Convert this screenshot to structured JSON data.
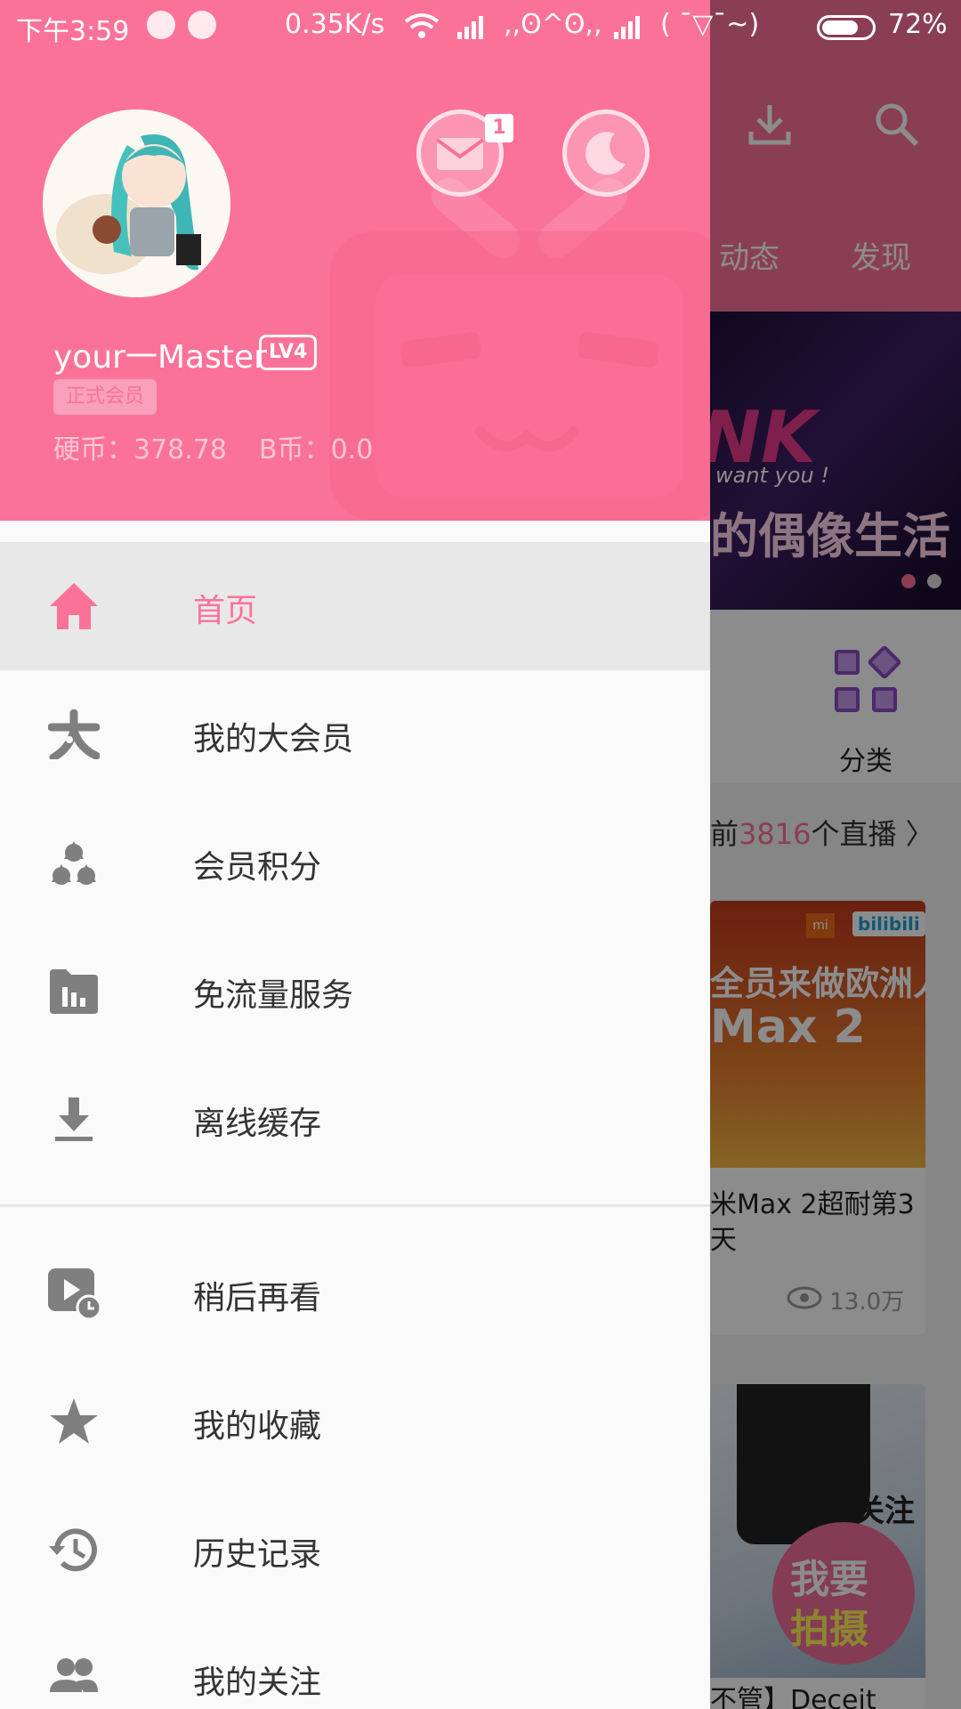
{
  "status_bar": {
    "time": "下午3:59",
    "speed": "0.35K/s",
    "signal_text": ",,ʘ^ʘ,,",
    "face_text": "( ¯▽¯~)",
    "battery": "72%"
  },
  "colors": {
    "accent": "#FB7299",
    "mail_button": "#FDD2DD",
    "night_button": "#FED8E2",
    "label": "#333333",
    "icon": "#7F7F7F",
    "drawer_bg": "#FAFAFA",
    "coin_text": "#FDC6D6",
    "username": "#FFFFFF"
  },
  "profile": {
    "username": "your一Master",
    "level": "LV4",
    "member_tag": "正式会员",
    "hard_coins": "硬币：378.78",
    "b_coins": "B币：0.0",
    "mail_badge": "1"
  },
  "menu": [
    {
      "label": "首页",
      "icon": "home-icon",
      "active": true
    },
    {
      "label": "我的大会员",
      "icon": "vip-icon",
      "active": false
    },
    {
      "label": "会员积分",
      "icon": "points-icon",
      "active": false
    },
    {
      "label": "免流量服务",
      "icon": "free-data-icon",
      "active": false
    },
    {
      "label": "离线缓存",
      "icon": "download-icon",
      "active": false
    }
  ],
  "menu2": [
    {
      "label": "稍后再看",
      "icon": "watch-later-icon"
    },
    {
      "label": "我的收藏",
      "icon": "star-icon"
    },
    {
      "label": "历史记录",
      "icon": "history-icon"
    },
    {
      "label": "我的关注",
      "icon": "following-icon"
    }
  ],
  "background": {
    "tabs": [
      "动态",
      "发现"
    ],
    "banner_text_1": "NK",
    "banner_text_2": "want you !",
    "banner_text_3": "的偶像生活",
    "category_label": "分类",
    "live_prefix": "前",
    "live_count": "3816",
    "live_suffix": "个直播 〉",
    "card1_line1": "全员来做欧洲人",
    "card1_line2": "Max 2",
    "card1_title": "米Max 2超耐第3天",
    "card1_views": "13.0万",
    "card1_mi": "mi",
    "card1_bili": "bilibili",
    "card2_side": "求关注",
    "card2_title": "不管】Deceit",
    "fab_line1": "我要",
    "fab_line2": "拍摄"
  }
}
